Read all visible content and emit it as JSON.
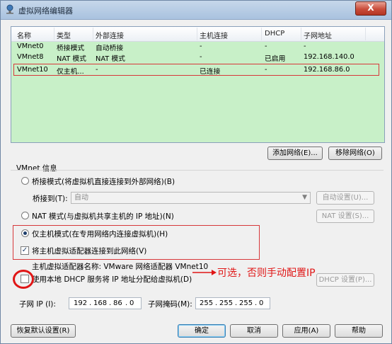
{
  "window": {
    "title": "虚拟网络编辑器",
    "close_label": "X"
  },
  "columns": [
    "名称",
    "类型",
    "外部连接",
    "主机连接",
    "DHCP",
    "子网地址"
  ],
  "rows": [
    {
      "name": "VMnet0",
      "type": "桥接模式",
      "external": "自动桥接",
      "host": "-",
      "dhcp": "-",
      "subnet": "-"
    },
    {
      "name": "VMnet8",
      "type": "NAT 模式",
      "external": "NAT 模式",
      "host": "-",
      "dhcp": "已启用",
      "subnet": "192.168.140.0"
    },
    {
      "name": "VMnet10",
      "type": "仅主机...",
      "external": "-",
      "host": "已连接",
      "dhcp": "-",
      "subnet": "192.168.86.0"
    }
  ],
  "table_buttons": {
    "add": "添加网络(E)...",
    "remove": "移除网络(O)"
  },
  "vmnet_info": {
    "heading": "VMnet 信息",
    "bridge_label": "桥接模式(将虚拟机直接连接到外部网络)(B)",
    "bridge_to_label": "桥接到(T):",
    "bridge_to_value": "自动",
    "auto_settings": "自动设置(U)...",
    "nat_label": "NAT 模式(与虚拟机共享主机的 IP 地址)(N)",
    "nat_settings": "NAT 设置(S)...",
    "host_only_label": "仅主机模式(在专用网络内连接虚拟机)(H)",
    "connect_adapter_label": "将主机虚拟适配器连接到此网络(V)",
    "adapter_name": "主机虚拟适配器名称: VMware 网络适配器 VMnet10",
    "dhcp_label": "使用本地 DHCP 服务将 IP 地址分配给虚拟机(D)",
    "dhcp_settings": "DHCP 设置(P)...",
    "subnet_ip_label": "子网 IP (I):",
    "subnet_ip": [
      "192",
      "168",
      "86",
      "0"
    ],
    "subnet_mask_label": "子网掩码(M):",
    "subnet_mask": [
      "255",
      "255",
      "255",
      "0"
    ]
  },
  "annotation": "可选，否则手动配置IP",
  "footer": {
    "restore": "恢复默认设置(R)",
    "ok": "确定",
    "cancel": "取消",
    "apply": "应用(A)",
    "help": "帮助"
  },
  "colors": {
    "table_bg": "#c8f0c8",
    "highlight": "#d7383a",
    "annotation": "#e01616"
  }
}
